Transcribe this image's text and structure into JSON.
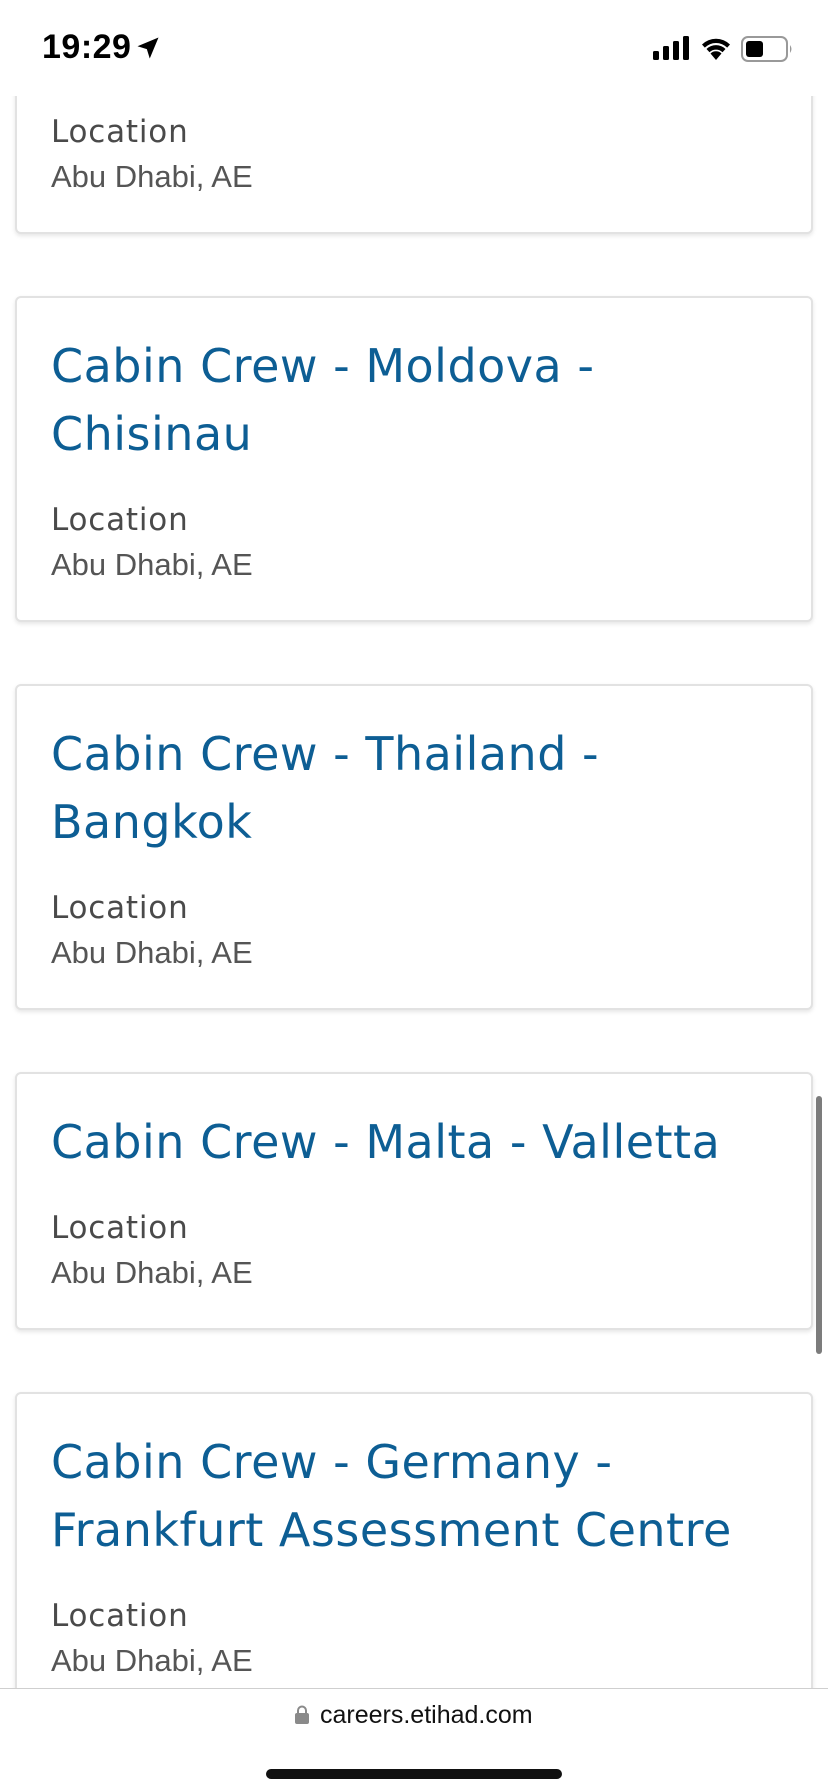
{
  "status": {
    "time": "19:29"
  },
  "jobs": [
    {
      "title": "",
      "location_label": "Location",
      "location": "Abu Dhabi, AE"
    },
    {
      "title": "Cabin Crew - Moldova - Chisinau",
      "location_label": "Location",
      "location": "Abu Dhabi, AE"
    },
    {
      "title": "Cabin Crew - Thailand - Bangkok",
      "location_label": "Location",
      "location": "Abu Dhabi, AE"
    },
    {
      "title": "Cabin Crew - Malta - Valletta",
      "location_label": "Location",
      "location": "Abu Dhabi, AE"
    },
    {
      "title": "Cabin Crew - Germany - Frankfurt Assessment Centre",
      "location_label": "Location",
      "location": "Abu Dhabi, AE"
    }
  ],
  "browser": {
    "url": "careers.etihad.com"
  },
  "icons": {
    "location": "location-arrow-icon",
    "signal": "cellular-signal-icon",
    "wifi": "wifi-icon",
    "battery": "battery-icon",
    "lock": "lock-icon"
  },
  "colors": {
    "title": "#0d5e94",
    "label": "#4a4a4a",
    "text": "#555555"
  }
}
